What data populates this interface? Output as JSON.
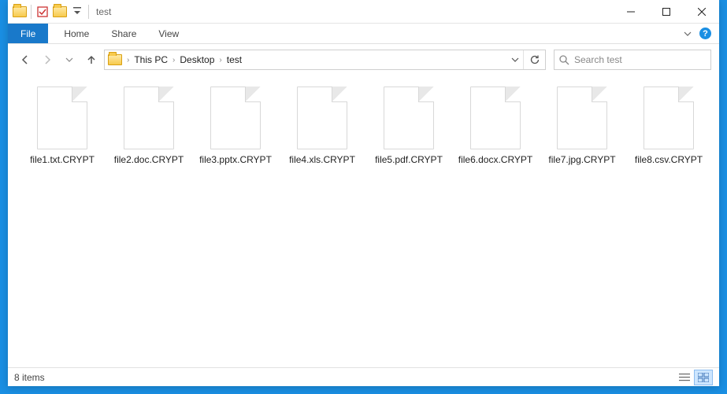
{
  "window": {
    "title": "test"
  },
  "ribbon": {
    "file": "File",
    "tabs": [
      "Home",
      "Share",
      "View"
    ]
  },
  "breadcrumbs": [
    "This PC",
    "Desktop",
    "test"
  ],
  "search": {
    "placeholder": "Search test"
  },
  "files": [
    {
      "name": "file1.txt.CRYPT"
    },
    {
      "name": "file2.doc.CRYPT"
    },
    {
      "name": "file3.pptx.CRYPT"
    },
    {
      "name": "file4.xls.CRYPT"
    },
    {
      "name": "file5.pdf.CRYPT"
    },
    {
      "name": "file6.docx.CRYPT"
    },
    {
      "name": "file7.jpg.CRYPT"
    },
    {
      "name": "file8.csv.CRYPT"
    }
  ],
  "status": {
    "count_label": "8 items"
  }
}
